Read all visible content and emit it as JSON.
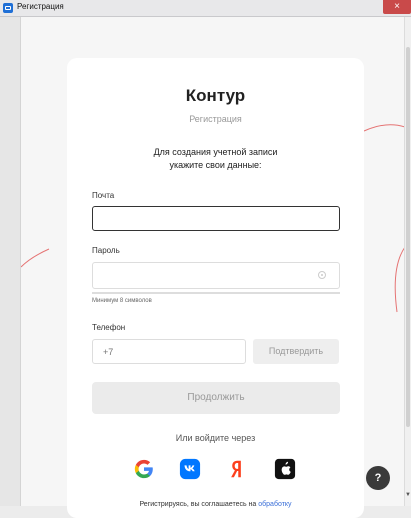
{
  "window": {
    "title": "Регистрация",
    "close_glyph": "×"
  },
  "brand": {
    "logo": "Контур",
    "subtitle": "Регистрация"
  },
  "intro": {
    "line1": "Для создания учетной записи",
    "line2": "укажите свои данные:"
  },
  "form": {
    "email_label": "Почта",
    "email_value": "",
    "password_label": "Пароль",
    "password_value": "",
    "password_hint": "Минимум 8 символов",
    "phone_label": "Телефон",
    "phone_placeholder": "+7",
    "confirm_button": "Подтвердить",
    "continue_button": "Продолжить"
  },
  "social": {
    "or_label": "Или войдите через",
    "providers": [
      "google-icon",
      "vk-icon",
      "yandex-icon",
      "apple-icon"
    ]
  },
  "footer": {
    "text": "Регистрируясь, вы соглашаетесь на ",
    "link": "обработку"
  },
  "help": {
    "label": "?"
  },
  "colors": {
    "accent": "#1f6fd6",
    "google_red": "#ea4335",
    "vk_blue": "#0077ff",
    "yandex_red": "#fc3f1d",
    "decor_line": "#e57373"
  }
}
